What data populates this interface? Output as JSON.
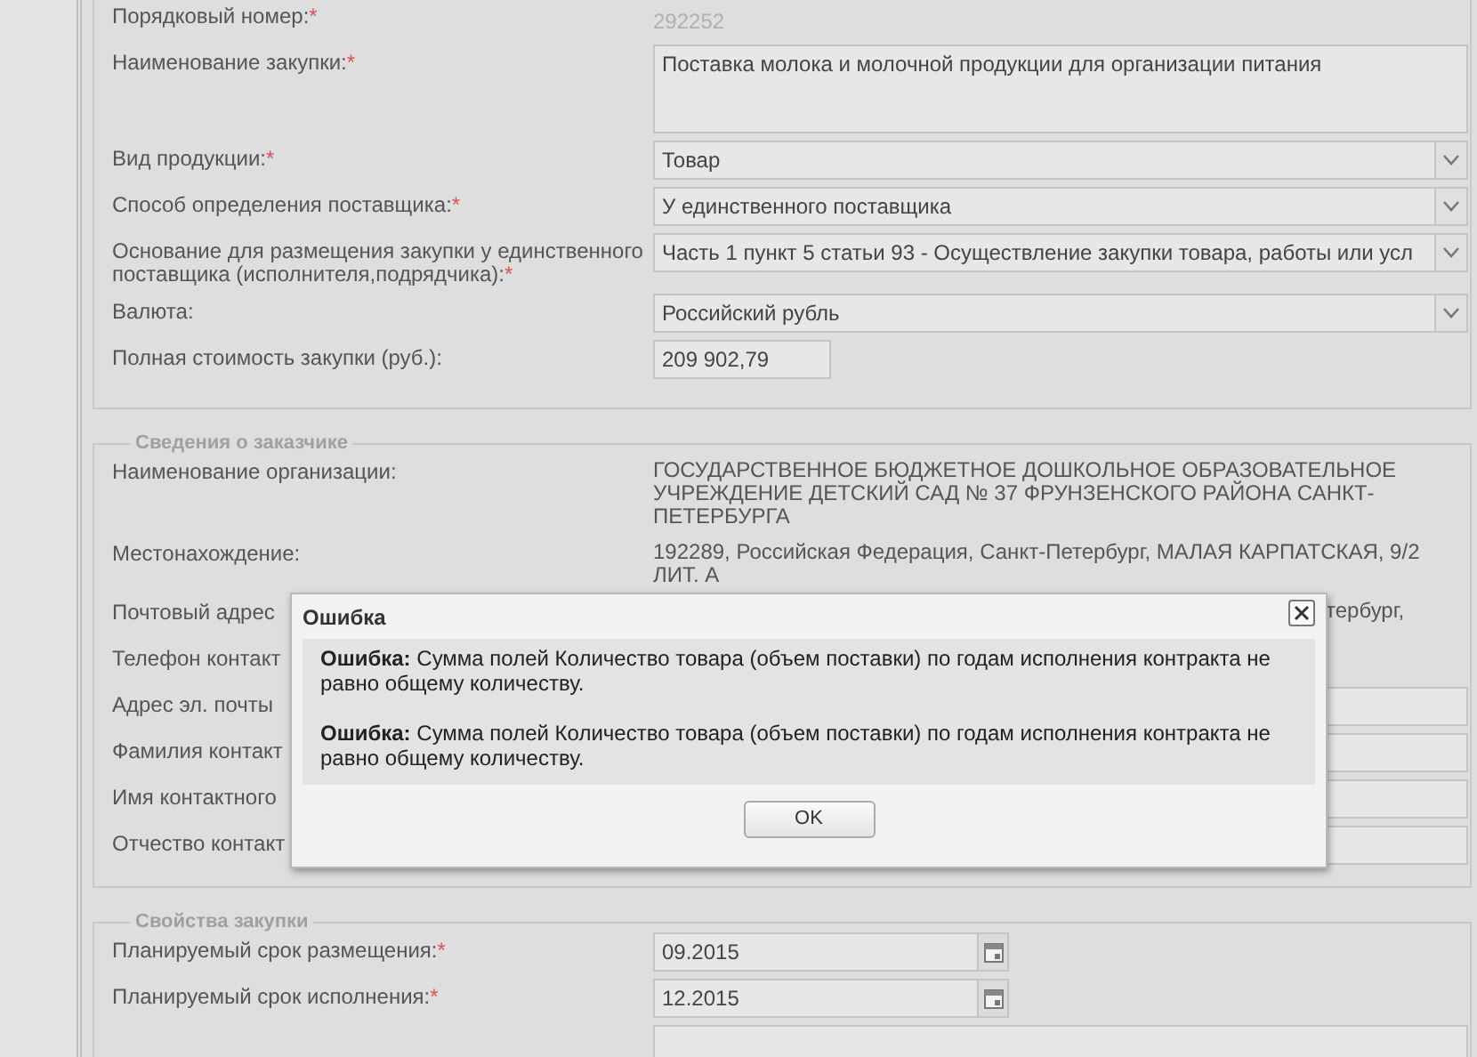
{
  "sections": [
    {
      "rows": [
        {
          "label": "Порядковый номер:",
          "required_mark": "*",
          "kind": "readonly",
          "value": "292252"
        },
        {
          "label": "Наименование закупки:",
          "required_mark": "*",
          "kind": "textarea",
          "value": "Поставка молока и молочной продукции для организации питания"
        },
        {
          "label": "Вид продукции:",
          "required_mark": "*",
          "kind": "select",
          "value": "Товар"
        },
        {
          "label": "Способ определения поставщика:",
          "required_mark": "*",
          "kind": "select",
          "value": "У единственного поставщика"
        },
        {
          "label": "Основание для размещения закупки у единственного поставщика (исполнителя,подрядчика):",
          "required_mark": "*",
          "kind": "select",
          "value": "Часть 1 пункт 5 статьи 93 - Осуществление закупки товара, работы или усл"
        },
        {
          "label": "Валюта:",
          "kind": "select",
          "value": "Российский рубль"
        },
        {
          "label": "Полная стоимость закупки (руб.):",
          "kind": "input",
          "value": "209 902,79"
        }
      ]
    },
    {
      "legend": "Сведения о заказчике",
      "rows": [
        {
          "label": "Наименование организации:",
          "kind": "text",
          "value": "ГОСУДАРСТВЕННОЕ БЮДЖЕТНОЕ ДОШКОЛЬНОЕ ОБРАЗОВАТЕЛЬНОЕ УЧРЕЖДЕНИЕ ДЕТСКИЙ САД № 37 ФРУНЗЕНСКОГО РАЙОНА САНКТ-ПЕТЕРБУРГА"
        },
        {
          "label": "Местонахождение:",
          "kind": "text",
          "value": "192289, Российская Федерация, Санкт-Петербург, МАЛАЯ КАРПАТСКАЯ, 9/2 ЛИТ. А"
        },
        {
          "label": "Почтовый адрес",
          "kind": "covered_text",
          "value": "тербург,"
        },
        {
          "label": "Телефон контакт",
          "kind": "covered"
        },
        {
          "label": "Адрес эл. почты",
          "kind": "covered_field"
        },
        {
          "label": "Фамилия контакт",
          "kind": "covered_field"
        },
        {
          "label": "Имя контактного",
          "kind": "covered_field"
        },
        {
          "label": "Отчество контакт",
          "kind": "covered_field"
        }
      ]
    },
    {
      "legend": "Свойства закупки",
      "rows": [
        {
          "label": "Планируемый срок размещения:",
          "required_mark": "*",
          "kind": "date",
          "value": "09.2015"
        },
        {
          "label": "Планируемый срок исполнения:",
          "required_mark": "*",
          "kind": "date",
          "value": "12.2015"
        },
        {
          "kind": "input"
        }
      ]
    }
  ],
  "dialog": {
    "title": "Ошибка",
    "messages": [
      "**Ошибка:** Сумма полей Количество товара (объем поставки) по годам исполнения контракта не равно общему количеству.",
      "**Ошибка:** Сумма полей Количество товара (объем поставки) по годам исполнения контракта не равно общему количеству."
    ],
    "button": "OK"
  }
}
